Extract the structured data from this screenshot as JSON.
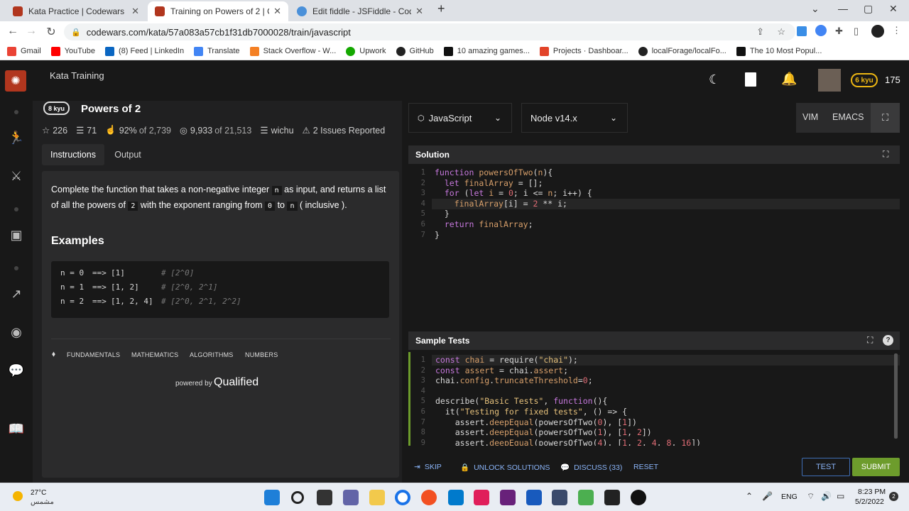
{
  "browser": {
    "tabs": [
      {
        "title": "Kata Practice | Codewars",
        "active": false
      },
      {
        "title": "Training on Powers of 2 | Codewars",
        "active": true
      },
      {
        "title": "Edit fiddle - JSFiddle - Code Play",
        "active": false
      }
    ],
    "url": "codewars.com/kata/57a083a57cb1f31db7000028/train/javascript",
    "bookmarks": [
      "Gmail",
      "YouTube",
      "(8) Feed | LinkedIn",
      "Translate",
      "Stack Overflow - W...",
      "Upwork",
      "GitHub",
      "10 amazing games...",
      "Projects · Dashboar...",
      "localForage/localFo...",
      "The 10 Most Popul..."
    ]
  },
  "header": {
    "section": "Kata Training",
    "rank": "6 kyu",
    "honor": "175"
  },
  "kata": {
    "rank": "8 kyu",
    "title": "Powers of 2",
    "stars": "226",
    "collections": "71",
    "satisfaction_pct": "92%",
    "satisfaction_of": "of 2,739",
    "completions": "9,933",
    "completions_of": "of 21,513",
    "author": "wichu",
    "issues": "2 Issues Reported",
    "tabs": [
      "Instructions",
      "Output"
    ],
    "desc_1": "Complete the function that takes a non-negative integer",
    "desc_n": "n",
    "desc_2": "as input, and returns a",
    "desc_3": "list of all the powers of",
    "desc_two": "2",
    "desc_4": "with the exponent ranging from",
    "desc_zero": "0",
    "desc_to": "to",
    "desc_n2": "n",
    "desc_5": "( inclusive ).",
    "examples_heading": "Examples",
    "examples": [
      {
        "n": "n = 0",
        "arrow": "==>",
        "result": "[1]",
        "comment": "# [2^0]"
      },
      {
        "n": "n = 1",
        "arrow": "==>",
        "result": "[1, 2]",
        "comment": "# [2^0, 2^1]"
      },
      {
        "n": "n = 2",
        "arrow": "==>",
        "result": "[1, 2, 4]",
        "comment": "# [2^0, 2^1, 2^2]"
      }
    ],
    "tags": [
      "FUNDAMENTALS",
      "MATHEMATICS",
      "ALGORITHMS",
      "NUMBERS"
    ],
    "powered_by": "powered by",
    "qualified": "Qualified"
  },
  "editor": {
    "language": "JavaScript",
    "runtime": "Node v14.x",
    "vim": "VIM",
    "emacs": "EMACS",
    "solution_title": "Solution",
    "solution_lines": [
      "1",
      "2",
      "3",
      "4",
      "5",
      "6",
      "7"
    ],
    "sample_title": "Sample Tests",
    "sample_lines": [
      "1",
      "2",
      "3",
      "4",
      "5",
      "6",
      "7",
      "8",
      "9"
    ]
  },
  "footer": {
    "skip": "SKIP",
    "unlock": "UNLOCK SOLUTIONS",
    "discuss": "DISCUSS (33)",
    "reset": "RESET",
    "test": "TEST",
    "submit": "SUBMIT"
  },
  "taskbar": {
    "temp": "27°C",
    "weather": "مشمس",
    "lang": "ENG",
    "time": "8:23 PM",
    "date": "5/2/2022",
    "badge": "2"
  },
  "colors": {
    "accent_red": "#b1361e",
    "submit_green": "#6d9c2c",
    "rank_yellow": "#ecb613",
    "link_blue": "#8ab4f8"
  }
}
